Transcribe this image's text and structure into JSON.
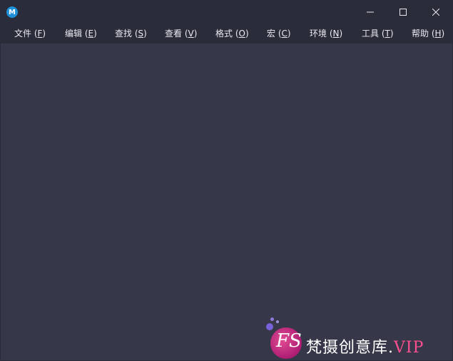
{
  "app_icon": {
    "glyph": "M",
    "color": "#1e90d8"
  },
  "window_controls": {
    "minimize": "minimize-icon",
    "maximize": "maximize-icon",
    "close": "close-icon"
  },
  "menu": {
    "items": [
      {
        "label": "文件",
        "key": "F"
      },
      {
        "label": "编辑",
        "key": "E"
      },
      {
        "label": "查找",
        "key": "S"
      },
      {
        "label": "查看",
        "key": "V"
      },
      {
        "label": "格式",
        "key": "O"
      },
      {
        "label": "宏",
        "key": "C"
      },
      {
        "label": "环境",
        "key": "N"
      },
      {
        "label": "工具",
        "key": "T"
      },
      {
        "label": "帮助",
        "key": "H"
      }
    ]
  },
  "watermark": {
    "logo": "FS",
    "text": "梵摄创意库.",
    "vip": "VIP"
  },
  "colors": {
    "titlebar": "#2b2c3a",
    "content": "#363849",
    "text": "#e8e9f0",
    "accent": "#ff4f8f"
  }
}
